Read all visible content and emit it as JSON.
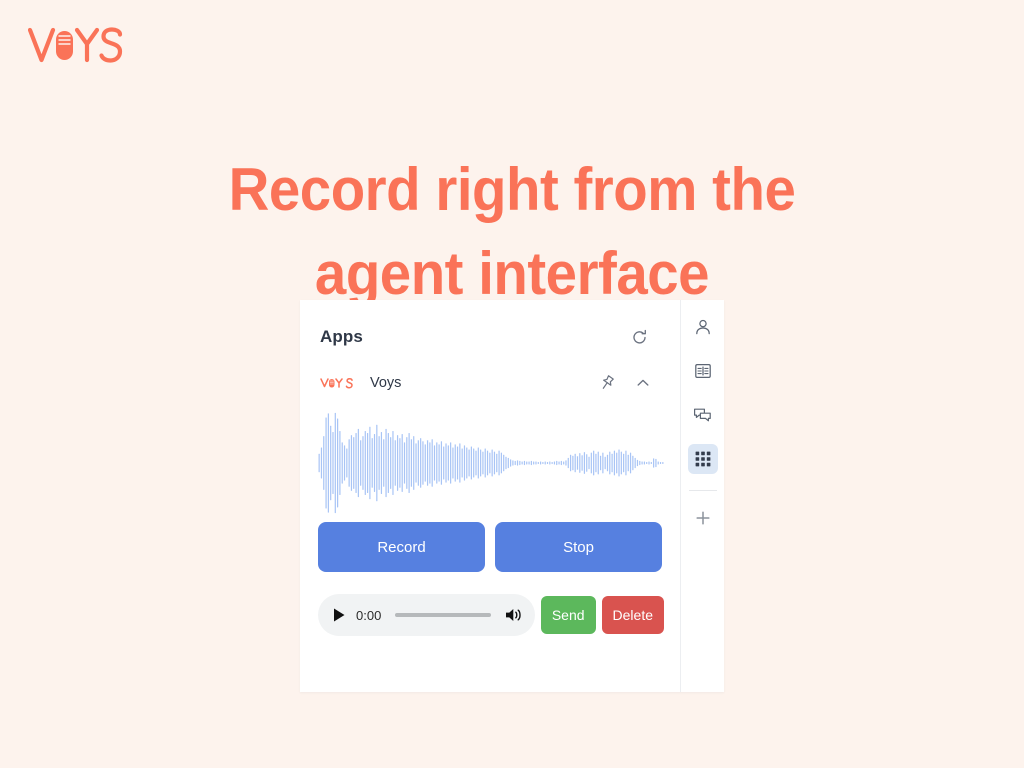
{
  "page": {
    "background_color": "#fdf3ed",
    "accent_color": "#fa7358"
  },
  "brand": {
    "name": "VOYS",
    "letters_before": "V",
    "letters_after": "YS",
    "mic_letter": "O",
    "color": "#fa7358"
  },
  "headline": {
    "line1": "Record right from the",
    "line2": "agent interface",
    "color": "#fa7358"
  },
  "app_card": {
    "header": {
      "title": "Apps",
      "refresh_icon": "refresh-icon"
    },
    "app": {
      "logo": "voys-logo-icon",
      "name": "Voys",
      "pin_icon": "pin-icon",
      "collapse_icon": "chevron-up-icon"
    },
    "waveform": {
      "color": "#a8c4f5",
      "bar_count": 150,
      "amplitudes": [
        0.18,
        0.3,
        0.52,
        0.88,
        0.96,
        0.72,
        0.6,
        0.97,
        0.86,
        0.62,
        0.4,
        0.34,
        0.28,
        0.46,
        0.54,
        0.5,
        0.58,
        0.66,
        0.44,
        0.52,
        0.62,
        0.58,
        0.7,
        0.48,
        0.56,
        0.74,
        0.52,
        0.6,
        0.46,
        0.66,
        0.58,
        0.5,
        0.62,
        0.44,
        0.54,
        0.48,
        0.56,
        0.4,
        0.5,
        0.58,
        0.46,
        0.52,
        0.38,
        0.44,
        0.48,
        0.42,
        0.36,
        0.44,
        0.4,
        0.46,
        0.34,
        0.4,
        0.36,
        0.42,
        0.32,
        0.38,
        0.34,
        0.4,
        0.3,
        0.36,
        0.32,
        0.38,
        0.28,
        0.34,
        0.3,
        0.26,
        0.32,
        0.28,
        0.24,
        0.3,
        0.26,
        0.22,
        0.28,
        0.24,
        0.2,
        0.26,
        0.22,
        0.18,
        0.24,
        0.2,
        0.16,
        0.12,
        0.1,
        0.07,
        0.05,
        0.04,
        0.05,
        0.04,
        0.03,
        0.04,
        0.03,
        0.03,
        0.04,
        0.03,
        0.03,
        0.02,
        0.03,
        0.02,
        0.03,
        0.02,
        0.03,
        0.02,
        0.03,
        0.04,
        0.03,
        0.04,
        0.03,
        0.05,
        0.1,
        0.16,
        0.14,
        0.18,
        0.13,
        0.19,
        0.15,
        0.21,
        0.17,
        0.12,
        0.2,
        0.24,
        0.18,
        0.22,
        0.14,
        0.2,
        0.12,
        0.16,
        0.22,
        0.18,
        0.24,
        0.2,
        0.26,
        0.22,
        0.18,
        0.24,
        0.16,
        0.2,
        0.14,
        0.1,
        0.06,
        0.04,
        0.03,
        0.03,
        0.02,
        0.03,
        0.02,
        0.09,
        0.08,
        0.03,
        0.02,
        0.02
      ]
    },
    "buttons": {
      "record_label": "Record",
      "stop_label": "Stop",
      "color": "#5680e0"
    },
    "player": {
      "play_icon": "play-icon",
      "time": "0:00",
      "seek_icon": "seek-slider",
      "volume_icon": "volume-icon",
      "send_label": "Send",
      "send_color": "#5cb85c",
      "delete_label": "Delete",
      "delete_color": "#d9534f"
    },
    "rail": {
      "items": [
        {
          "icon": "person-icon",
          "active": false
        },
        {
          "icon": "contacts-book-icon",
          "active": false
        },
        {
          "icon": "chat-bubbles-icon",
          "active": false
        },
        {
          "icon": "apps-grid-icon",
          "active": true
        },
        {
          "icon": "plus-icon",
          "active": false
        }
      ]
    }
  }
}
